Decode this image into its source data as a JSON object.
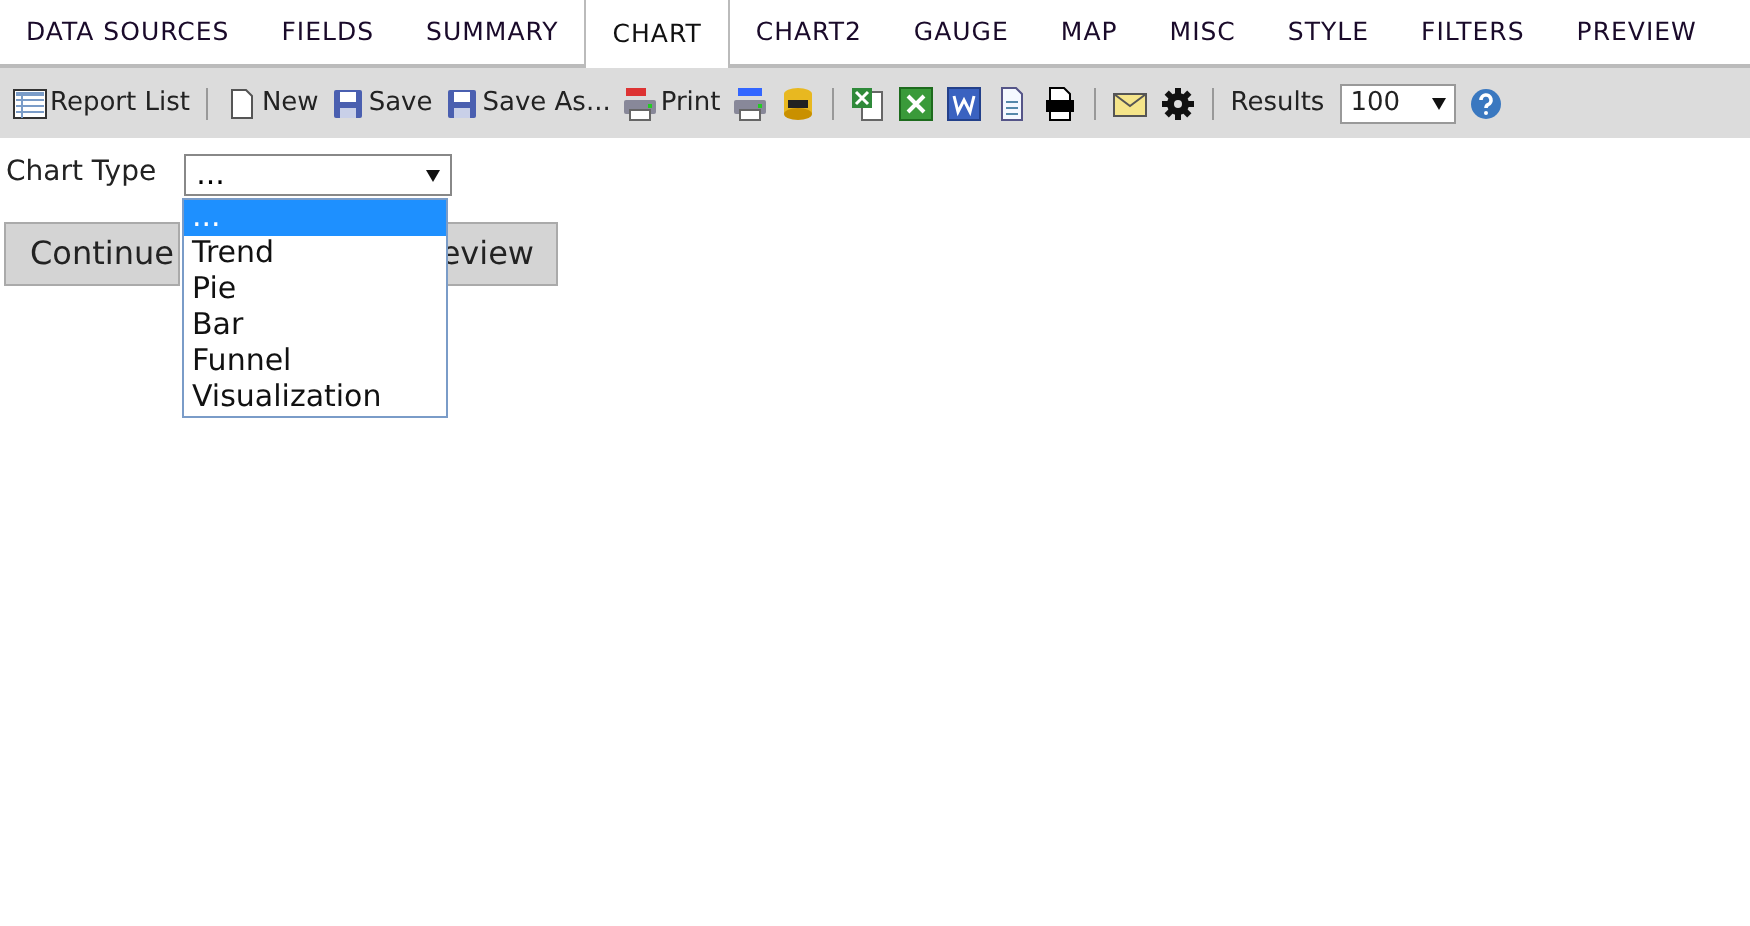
{
  "tabs": [
    {
      "label": "DATA SOURCES",
      "selected": false
    },
    {
      "label": "FIELDS",
      "selected": false
    },
    {
      "label": "SUMMARY",
      "selected": false
    },
    {
      "label": "CHART",
      "selected": true
    },
    {
      "label": "CHART2",
      "selected": false
    },
    {
      "label": "GAUGE",
      "selected": false
    },
    {
      "label": "MAP",
      "selected": false
    },
    {
      "label": "MISC",
      "selected": false
    },
    {
      "label": "STYLE",
      "selected": false
    },
    {
      "label": "FILTERS",
      "selected": false
    },
    {
      "label": "PREVIEW",
      "selected": false
    }
  ],
  "toolbar": [
    {
      "kind": "list",
      "label": "Report List"
    },
    {
      "kind": "sep"
    },
    {
      "kind": "new",
      "label": "New"
    },
    {
      "kind": "save",
      "label": "Save"
    },
    {
      "kind": "save",
      "label": "Save As..."
    },
    {
      "kind": "pdf",
      "label": "Print"
    },
    {
      "kind": "html"
    },
    {
      "kind": "sql"
    },
    {
      "kind": "sep"
    },
    {
      "kind": "excel2"
    },
    {
      "kind": "excel"
    },
    {
      "kind": "word"
    },
    {
      "kind": "xml"
    },
    {
      "kind": "rtf"
    },
    {
      "kind": "sep"
    },
    {
      "kind": "mail"
    },
    {
      "kind": "gear"
    },
    {
      "kind": "sep"
    },
    {
      "kind": "results",
      "label": "Results",
      "value": "100"
    },
    {
      "kind": "help"
    }
  ],
  "chart_type": {
    "label": "Chart Type",
    "value": "...",
    "options": [
      {
        "label": "...",
        "selected": true
      },
      {
        "label": "Trend",
        "selected": false
      },
      {
        "label": "Pie",
        "selected": false
      },
      {
        "label": "Bar",
        "selected": false
      },
      {
        "label": "Funnel",
        "selected": false
      },
      {
        "label": "Visualization",
        "selected": false
      }
    ]
  },
  "buttons": [
    "Continue",
    "eview"
  ]
}
